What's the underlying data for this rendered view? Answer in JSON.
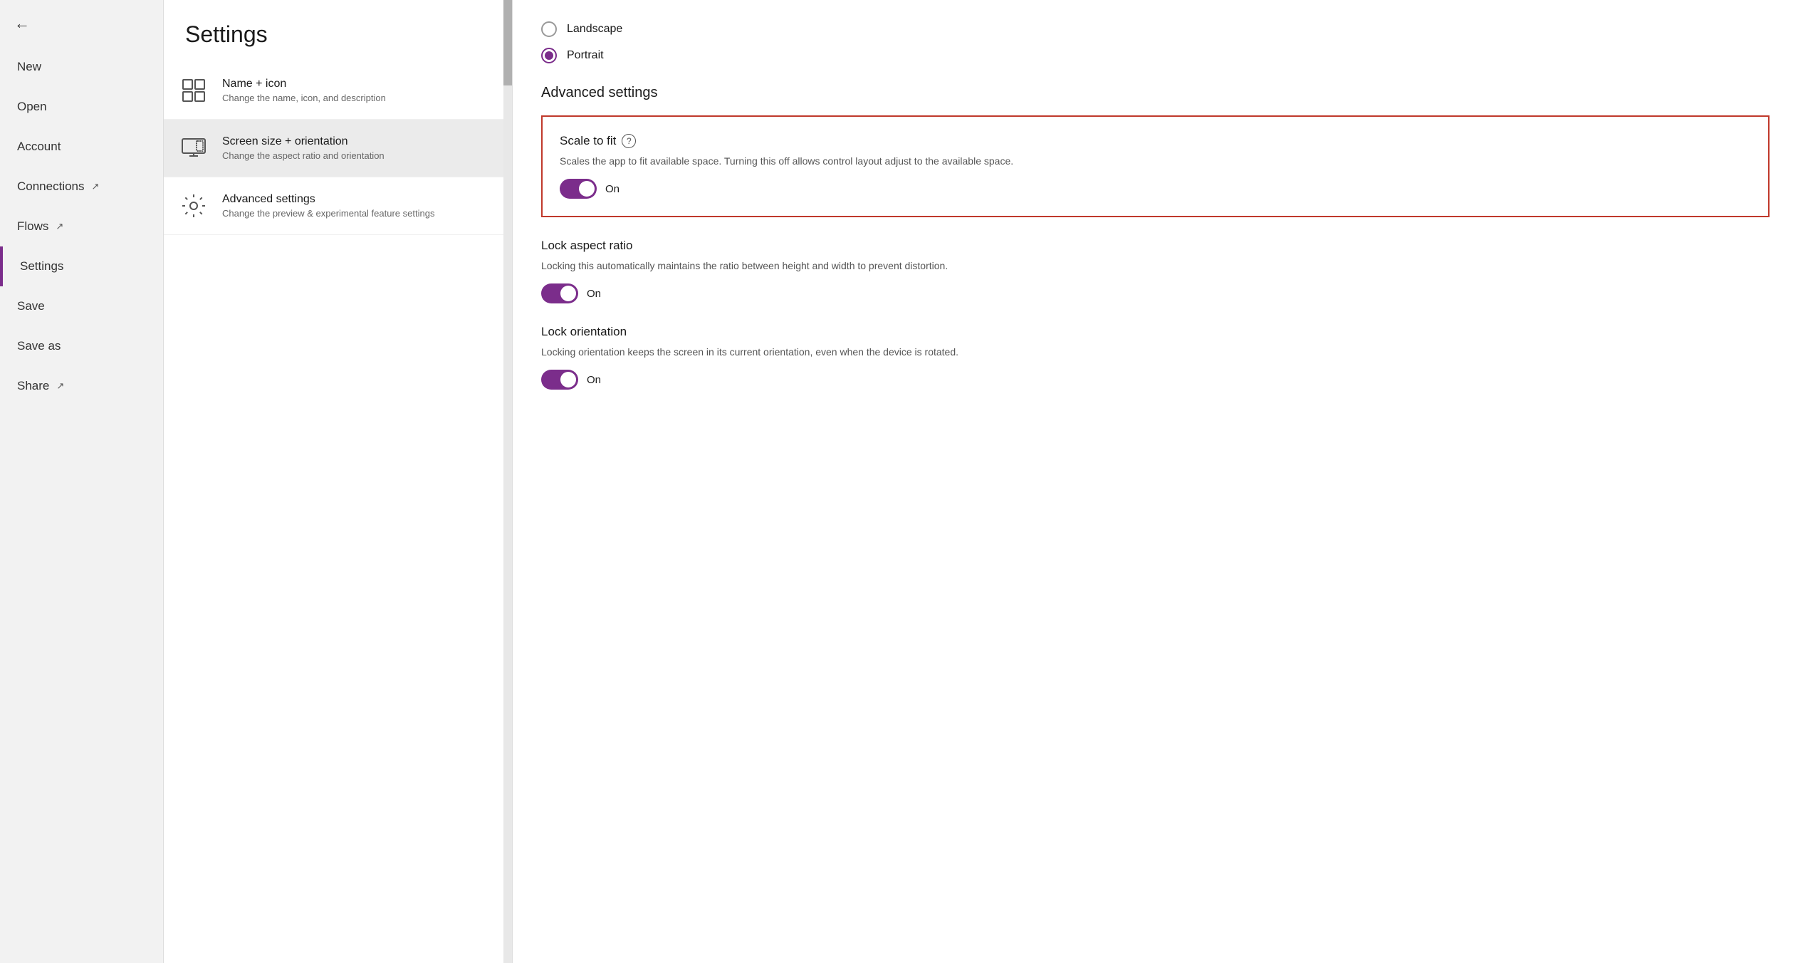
{
  "sidebar": {
    "back_label": "←",
    "items": [
      {
        "id": "new",
        "label": "New",
        "external": false,
        "active": false
      },
      {
        "id": "open",
        "label": "Open",
        "external": false,
        "active": false
      },
      {
        "id": "account",
        "label": "Account",
        "external": false,
        "active": false
      },
      {
        "id": "connections",
        "label": "Connections",
        "external": true,
        "active": false
      },
      {
        "id": "flows",
        "label": "Flows",
        "external": true,
        "active": false
      },
      {
        "id": "settings",
        "label": "Settings",
        "external": false,
        "active": true
      },
      {
        "id": "save",
        "label": "Save",
        "external": false,
        "active": false
      },
      {
        "id": "save-as",
        "label": "Save as",
        "external": false,
        "active": false
      },
      {
        "id": "share",
        "label": "Share",
        "external": true,
        "active": false
      }
    ]
  },
  "page": {
    "title": "Settings"
  },
  "settings_menu": {
    "items": [
      {
        "id": "name-icon",
        "title": "Name + icon",
        "subtitle": "Change the name, icon, and description",
        "active": false
      },
      {
        "id": "screen-size",
        "title": "Screen size + orientation",
        "subtitle": "Change the aspect ratio and orientation",
        "active": true
      },
      {
        "id": "advanced",
        "title": "Advanced settings",
        "subtitle": "Change the preview & experimental feature settings",
        "active": false
      }
    ]
  },
  "content": {
    "orientation": {
      "options": [
        {
          "id": "landscape",
          "label": "Landscape",
          "selected": false
        },
        {
          "id": "portrait",
          "label": "Portrait",
          "selected": true
        }
      ]
    },
    "advanced_settings": {
      "title": "Advanced settings",
      "scale_to_fit": {
        "title": "Scale to fit",
        "has_help": true,
        "description": "Scales the app to fit available space. Turning this off allows control layout adjust to the available space.",
        "toggle_state": true,
        "toggle_label": "On"
      }
    },
    "lock_aspect_ratio": {
      "title": "Lock aspect ratio",
      "description": "Locking this automatically maintains the ratio between height and width to prevent distortion.",
      "toggle_state": true,
      "toggle_label": "On"
    },
    "lock_orientation": {
      "title": "Lock orientation",
      "description": "Locking orientation keeps the screen in its current orientation, even when the device is rotated.",
      "toggle_state": true,
      "toggle_label": "On"
    }
  }
}
